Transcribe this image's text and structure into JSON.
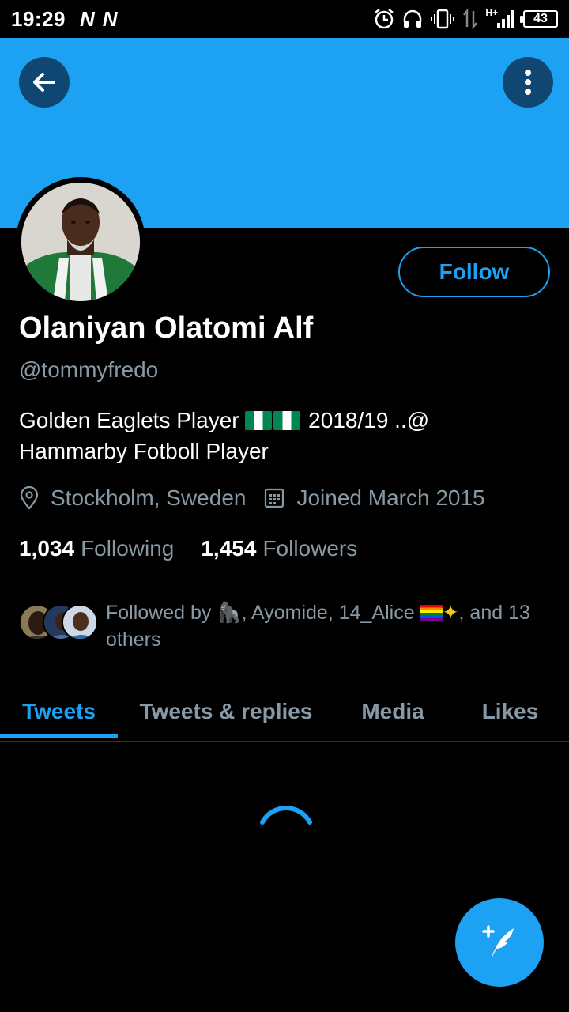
{
  "status_bar": {
    "time": "19:29",
    "notif_1": "N",
    "notif_2": "N",
    "network": "H+",
    "battery": "43"
  },
  "header": {
    "back_icon": "arrow-left-icon",
    "more_icon": "more-vertical-icon",
    "banner_color": "#1da1f2"
  },
  "profile": {
    "name": "Olaniyan Olatomi Alf",
    "handle": "@tommyfredo",
    "follow_label": "Follow",
    "bio_part1": "Golden Eaglets Player",
    "bio_part2": "2018/19 ..@",
    "bio_part3": "Hammarby Fotboll Player",
    "location": "Stockholm, Sweden",
    "joined": "Joined March 2015",
    "following_count": "1,034",
    "following_label": "Following",
    "followers_count": "1,454",
    "followers_label": "Followers",
    "followed_by_prefix": "Followed by",
    "followed_by_rest": ", Ayomide, 14_Alice",
    "followed_by_suffix": ", and 13 others"
  },
  "tabs": [
    {
      "label": "Tweets",
      "active": true
    },
    {
      "label": "Tweets & replies",
      "active": false
    },
    {
      "label": "Media",
      "active": false
    },
    {
      "label": "Likes",
      "active": false
    }
  ],
  "fab": {
    "icon": "compose-tweet-icon"
  },
  "colors": {
    "accent": "#1da1f2",
    "secondary_text": "#8899a6",
    "background": "#000000"
  }
}
